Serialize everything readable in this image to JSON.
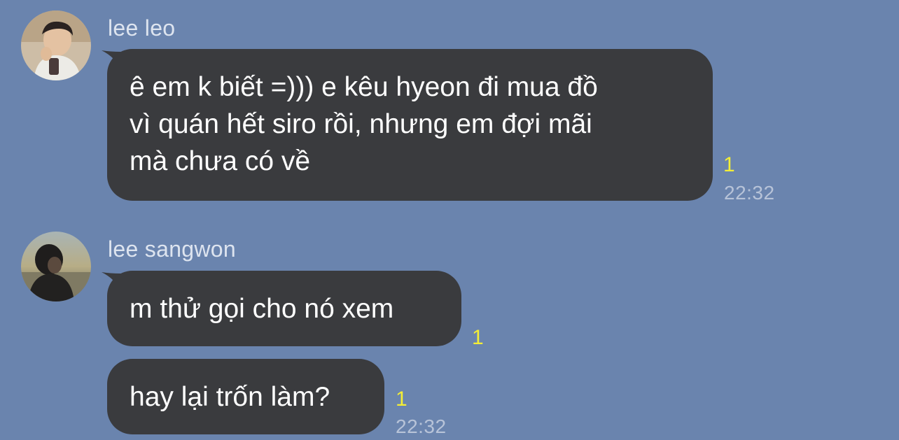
{
  "chat": {
    "groups": [
      {
        "sender": "lee leo",
        "messages": [
          {
            "text": "ê em k biết =))) e kêu hyeon đi mua đồ\nvì quán hết siro rồi, nhưng em đợi mãi\nmà chưa có về",
            "unread": "1",
            "time": "22:32"
          }
        ]
      },
      {
        "sender": "lee sangwon",
        "messages": [
          {
            "text": "m thử gọi cho nó xem",
            "unread": "1",
            "time": ""
          },
          {
            "text": "hay lại trốn làm?",
            "unread": "1",
            "time": "22:32"
          }
        ]
      }
    ]
  },
  "colors": {
    "background": "#6a84ae",
    "bubble": "#3a3b3e",
    "unread_count": "#f4ee35",
    "sender_name": "#dde4ef"
  }
}
